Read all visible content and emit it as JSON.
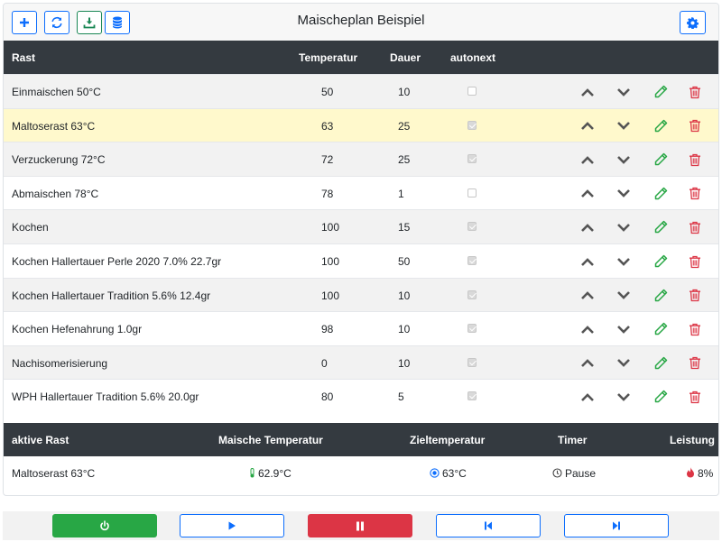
{
  "header": {
    "title": "Maischeplan Beispiel"
  },
  "toolbar": {
    "buttons": [
      {
        "icon": "plus-icon"
      },
      {
        "icon": "refresh-icon"
      },
      {
        "icon": "download-icon"
      },
      {
        "icon": "database-icon"
      }
    ],
    "settings_icon": "gear-icon"
  },
  "table": {
    "columns": {
      "rast": "Rast",
      "temperatur": "Temperatur",
      "dauer": "Dauer",
      "autonext": "autonext"
    },
    "rows": [
      {
        "name": "Einmaischen 50°C",
        "temp": "50",
        "dauer": "10",
        "autonext": false,
        "active": false
      },
      {
        "name": "Maltoserast 63°C",
        "temp": "63",
        "dauer": "25",
        "autonext": true,
        "active": true
      },
      {
        "name": "Verzuckerung 72°C",
        "temp": "72",
        "dauer": "25",
        "autonext": true,
        "active": false
      },
      {
        "name": "Abmaischen 78°C",
        "temp": "78",
        "dauer": "1",
        "autonext": false,
        "active": false
      },
      {
        "name": "Kochen",
        "temp": "100",
        "dauer": "15",
        "autonext": true,
        "active": false
      },
      {
        "name": "Kochen Hallertauer Perle 2020 7.0% 22.7gr",
        "temp": "100",
        "dauer": "50",
        "autonext": true,
        "active": false
      },
      {
        "name": "Kochen Hallertauer Tradition 5.6% 12.4gr",
        "temp": "100",
        "dauer": "10",
        "autonext": true,
        "active": false
      },
      {
        "name": "Kochen Hefenahrung 1.0gr",
        "temp": "98",
        "dauer": "10",
        "autonext": true,
        "active": false
      },
      {
        "name": "Nachisomerisierung",
        "temp": "0",
        "dauer": "10",
        "autonext": true,
        "active": false
      },
      {
        "name": "WPH Hallertauer Tradition 5.6% 20.0gr",
        "temp": "80",
        "dauer": "5",
        "autonext": true,
        "active": false
      }
    ]
  },
  "status": {
    "columns": {
      "aktive_rast": "aktive Rast",
      "maische_temp": "Maische Temperatur",
      "zieltemp": "Zieltemperatur",
      "timer": "Timer",
      "leistung": "Leistung"
    },
    "values": {
      "aktive_rast": "Maltoserast 63°C",
      "maische_temp": "62.9°C",
      "zieltemp": "63°C",
      "timer": "Pause",
      "leistung": "8%"
    }
  },
  "controls": [
    {
      "icon": "power-icon"
    },
    {
      "icon": "play-icon"
    },
    {
      "icon": "pause-icon"
    },
    {
      "icon": "skip-back-icon"
    },
    {
      "icon": "skip-forward-icon"
    }
  ],
  "colors": {
    "primary": "#0d6efd",
    "success": "#28a745",
    "danger": "#dc3545",
    "header_dark": "#343a40",
    "active_row": "#fff9cc",
    "edit_green": "#28a745",
    "arrow_gray": "#555555"
  }
}
